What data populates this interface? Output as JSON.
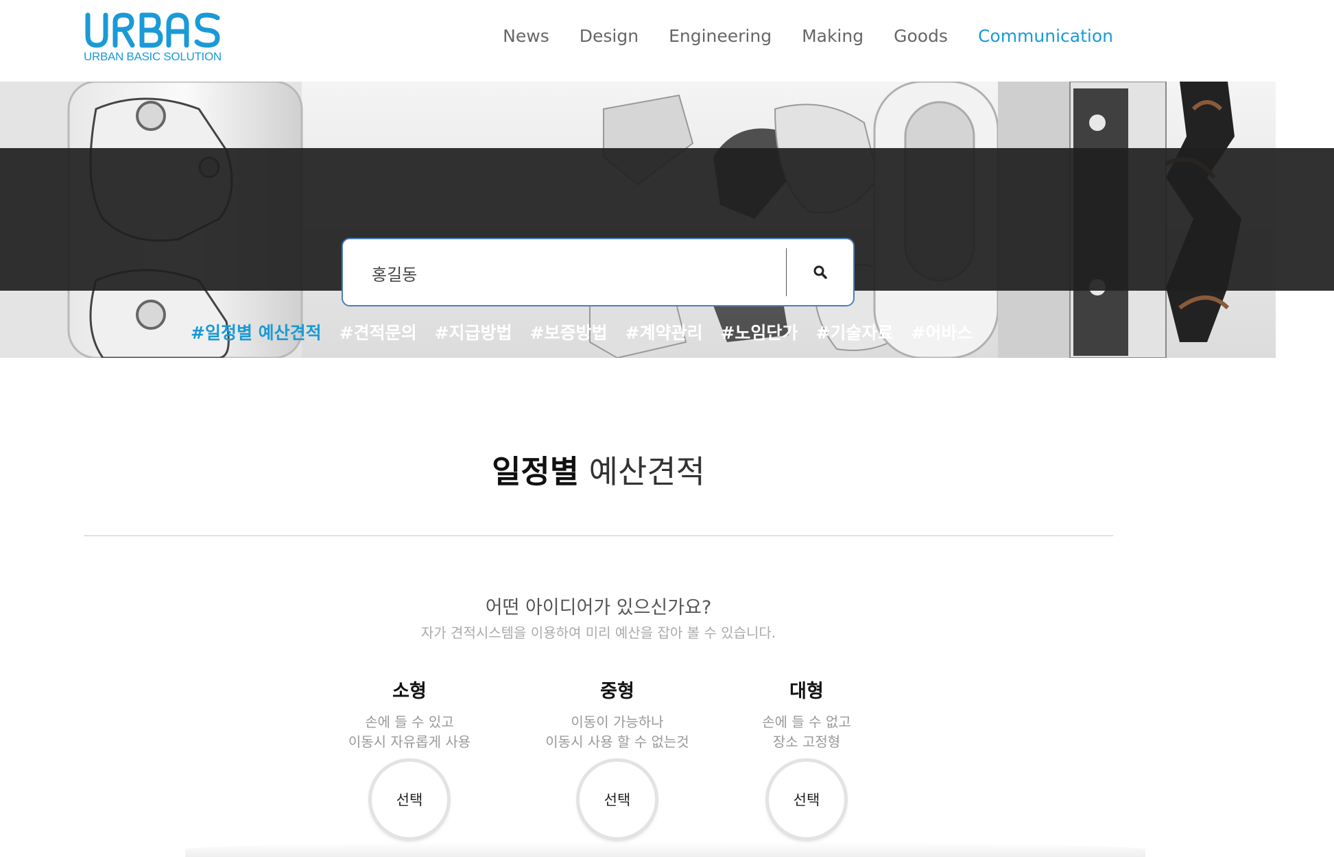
{
  "header": {
    "logo_text": "URBAS",
    "logo_tagline": "URBAN BASIC SOLUTION",
    "nav": [
      {
        "label": "News"
      },
      {
        "label": "Design"
      },
      {
        "label": "Engineering"
      },
      {
        "label": "Making"
      },
      {
        "label": "Goods"
      },
      {
        "label": "Communication",
        "active": true
      }
    ]
  },
  "search": {
    "value": "홍길동",
    "button_icon": "search-icon"
  },
  "tags": [
    {
      "label": "#일정별 예산견적",
      "active": true
    },
    {
      "label": "#견적문의"
    },
    {
      "label": "#지급방법"
    },
    {
      "label": "#보증방법"
    },
    {
      "label": "#계약관리"
    },
    {
      "label": "#노임단가"
    },
    {
      "label": "#기술자료"
    },
    {
      "label": "#어바스"
    }
  ],
  "section": {
    "title_bold": "일정별",
    "title_light": "예산견적",
    "question": "어떤 아이디어가 있으신가요?",
    "question_sub": "자가 견적시스템을 이용하여 미리 예산을 잡아 볼 수 있습니다."
  },
  "options": [
    {
      "title": "소형",
      "desc": "손에 들 수 있고\n이동시 자유롭게 사용",
      "button": "선택"
    },
    {
      "title": "중형",
      "desc": "이동이 가능하나\n이동시 사용 할 수 없는것",
      "button": "선택"
    },
    {
      "title": "대형",
      "desc": "손에 들 수 없고\n장소 고정형",
      "button": "선택"
    }
  ],
  "colors": {
    "accent": "#1a9ad6",
    "band": "#202020",
    "nav_text": "#666666"
  }
}
